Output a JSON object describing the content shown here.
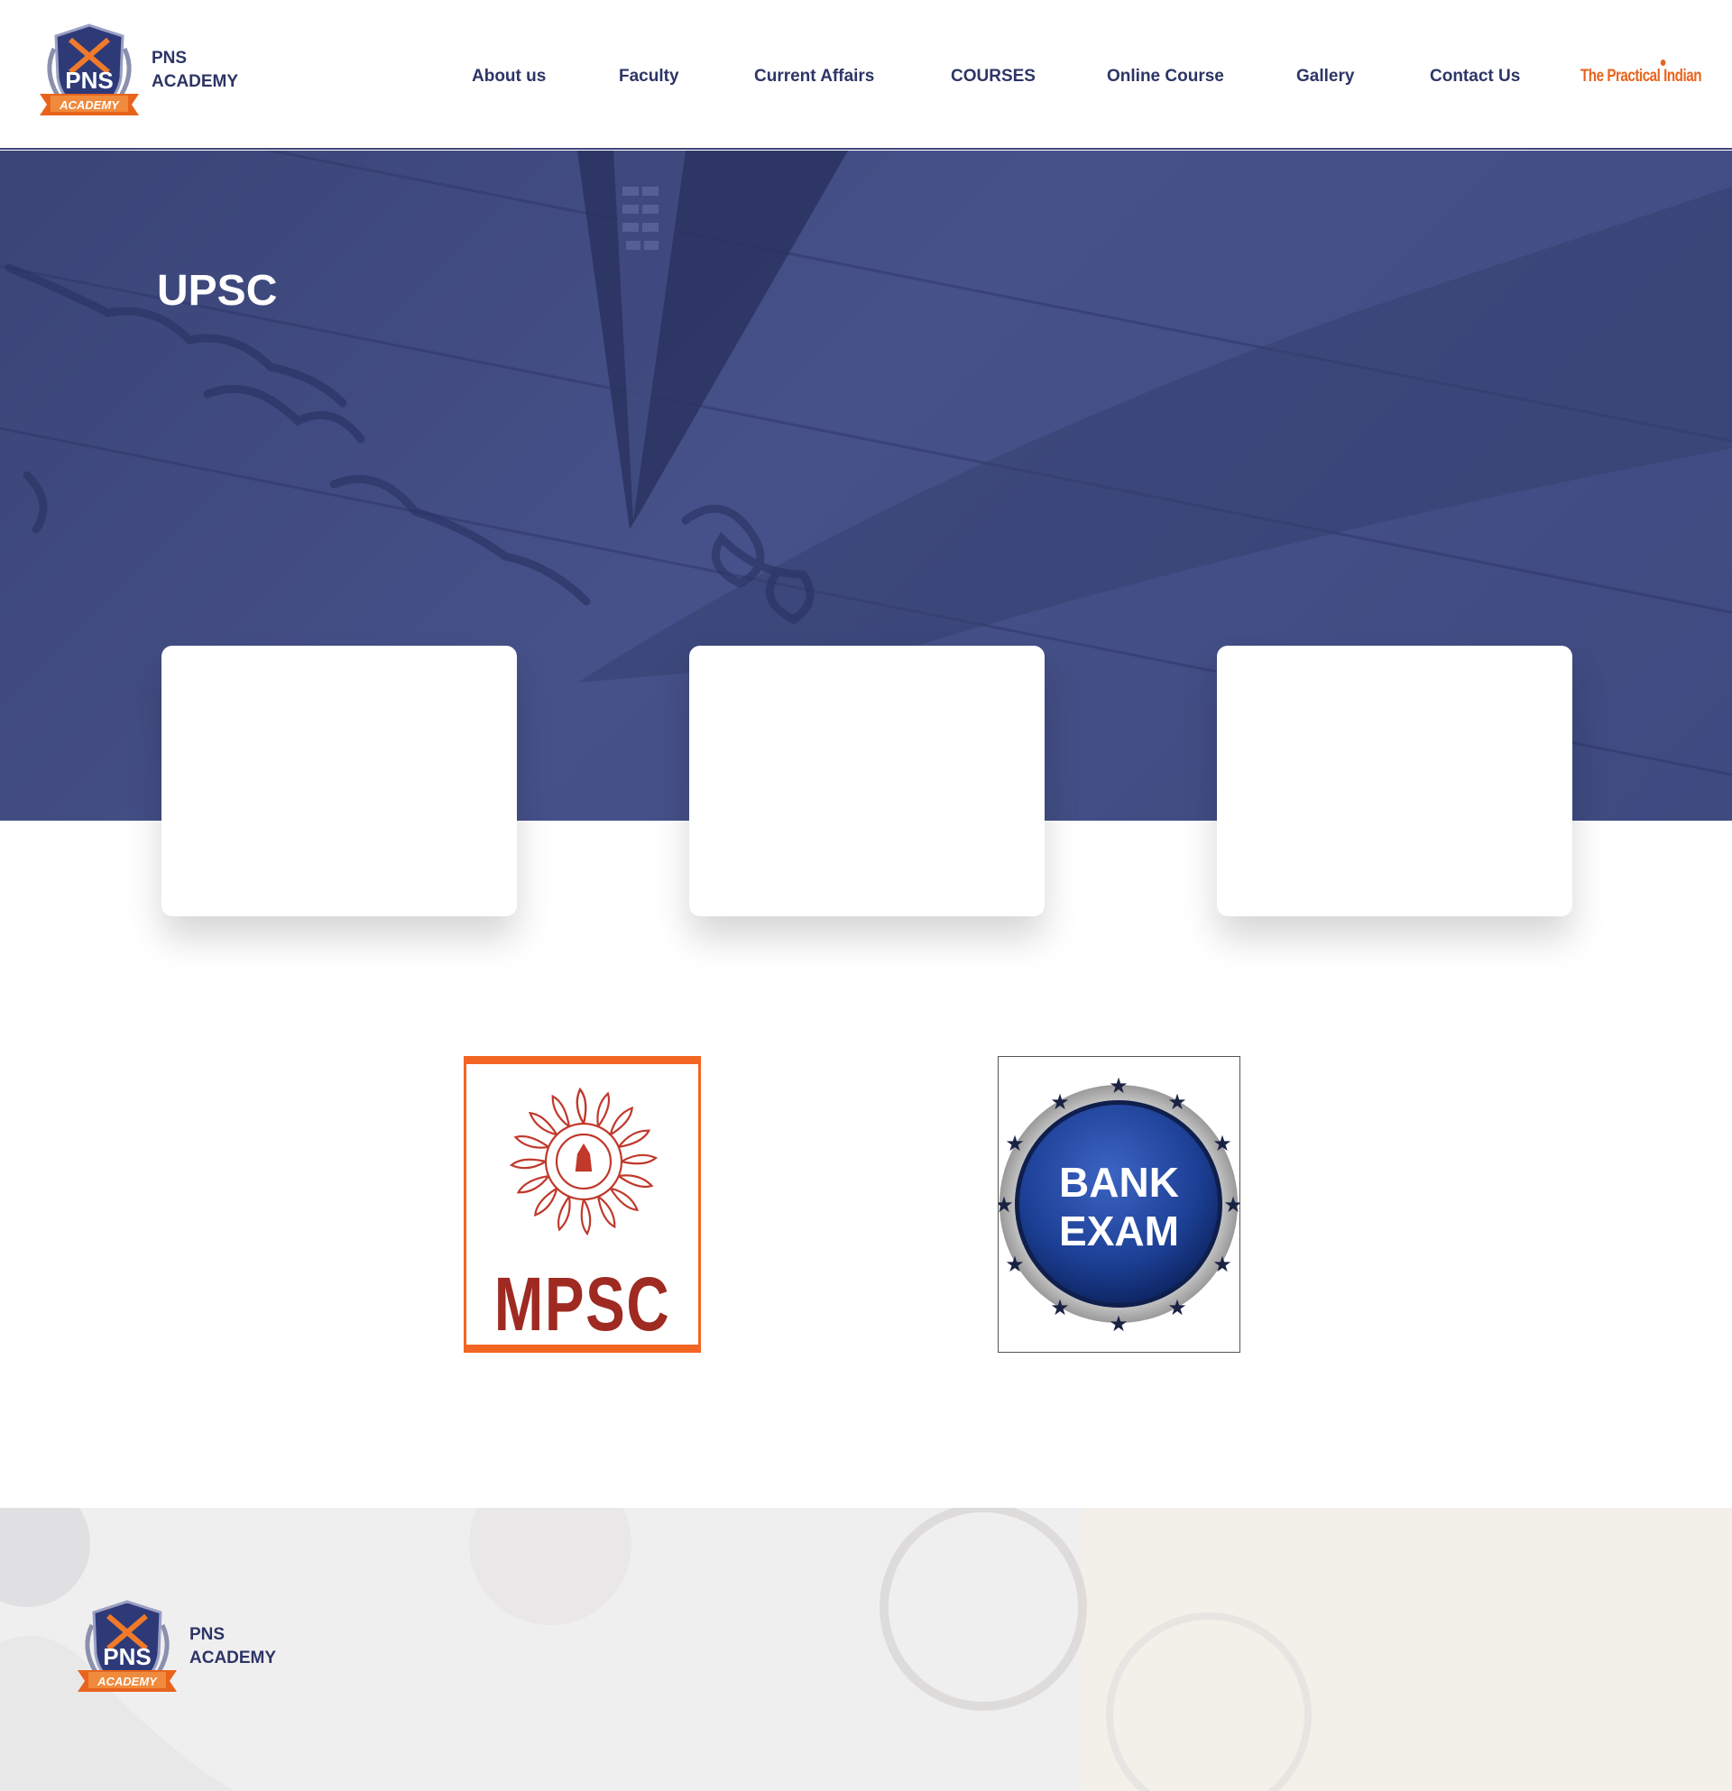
{
  "header": {
    "brand": {
      "line1": "PNS",
      "line2": "ACADEMY",
      "logo_text": "PNS",
      "logo_ribbon": "ACADEMY"
    },
    "nav": [
      {
        "label": "About us"
      },
      {
        "label": "Faculty"
      },
      {
        "label": "Current Affairs"
      },
      {
        "label": "COURSES"
      },
      {
        "label": "Online Course"
      },
      {
        "label": "Gallery"
      },
      {
        "label": "Contact Us"
      }
    ],
    "special_link": {
      "label": "The Practical Indian"
    }
  },
  "hero": {
    "title": "UPSC"
  },
  "exams": {
    "mpsc": {
      "label": "MPSC"
    },
    "bank": {
      "line1": "BANK",
      "line2": "EXAM"
    }
  },
  "footer": {
    "brand": {
      "line1": "PNS",
      "line2": "ACADEMY",
      "logo_text": "PNS",
      "logo_ribbon": "ACADEMY"
    }
  },
  "colors": {
    "brand_navy": "#2d3566",
    "hero_overlay": "#3e4a80",
    "accent_orange": "#e8641d",
    "mpsc_red": "#9e2a22",
    "bank_blue": "#1c3f94"
  },
  "icons": [
    "pns-academy-logo",
    "mpsc-emblem",
    "bank-exam-badge"
  ]
}
